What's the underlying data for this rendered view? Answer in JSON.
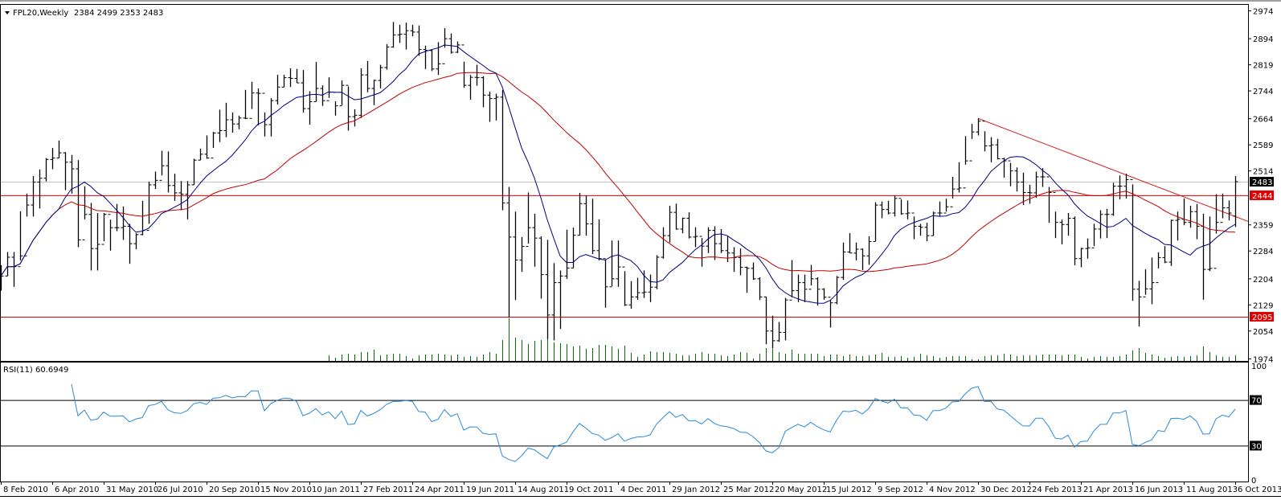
{
  "header": {
    "symbol_timeframe": "FPL20,Weekly",
    "ohlc_text": "2384 2499 2353 2483",
    "menu_icon": "triangle-down-icon"
  },
  "rsi_header": "RSI(11) 60.6949",
  "colors": {
    "bars": "#000000",
    "ma_fast": "#00007f",
    "ma_slow": "#c00000",
    "level_line": "#e00000",
    "trendline": "#d02020",
    "current_price_line": "#c0c0c0",
    "volume": "#007000",
    "rsi": "#2a8ad8"
  },
  "chart_data": [
    {
      "type": "ohlc",
      "title": "FPL20, Weekly",
      "bar_format": "[high, low, close]",
      "last_bar": {
        "open": 2384,
        "high": 2499,
        "low": 2353,
        "close": 2483
      },
      "ylim": [
        1974,
        2974
      ],
      "y_ticks": [
        "2974",
        "2894",
        "2819",
        "2744",
        "2664",
        "2589",
        "2514",
        "2359",
        "2284",
        "2204",
        "2129",
        "2054",
        "1974"
      ],
      "x_tick_labels": [
        {
          "bar": 1,
          "label": "8 Feb 2010"
        },
        {
          "bar": 9,
          "label": "6 Apr 2010"
        },
        {
          "bar": 17,
          "label": "31 May 2010"
        },
        {
          "bar": 25,
          "label": "26 Jul 2010"
        },
        {
          "bar": 33,
          "label": "20 Sep 2010"
        },
        {
          "bar": 41,
          "label": "15 Nov 2010"
        },
        {
          "bar": 49,
          "label": "10 Jan 2011"
        },
        {
          "bar": 57,
          "label": "27 Feb 2011"
        },
        {
          "bar": 65,
          "label": "24 Apr 2011"
        },
        {
          "bar": 73,
          "label": "19 Jun 2011"
        },
        {
          "bar": 81,
          "label": "14 Aug 2011"
        },
        {
          "bar": 89,
          "label": "9 Oct 2011"
        },
        {
          "bar": 97,
          "label": "4 Dec 2011"
        },
        {
          "bar": 105,
          "label": "29 Jan 2012"
        },
        {
          "bar": 113,
          "label": "25 Mar 2012"
        },
        {
          "bar": 121,
          "label": "20 May 2012"
        },
        {
          "bar": 129,
          "label": "15 Jul 2012"
        },
        {
          "bar": 137,
          "label": "9 Sep 2012"
        },
        {
          "bar": 145,
          "label": "4 Nov 2012"
        },
        {
          "bar": 153,
          "label": "30 Dec 2012"
        },
        {
          "bar": 161,
          "label": "24 Feb 2013"
        },
        {
          "bar": 169,
          "label": "21 Apr 2013"
        },
        {
          "bar": 177,
          "label": "16 Jun 2013"
        },
        {
          "bar": 185,
          "label": "11 Aug 2013"
        },
        {
          "bar": 193,
          "label": "6 Oct 2013"
        }
      ],
      "horizontal_levels": [
        {
          "price": 2444,
          "label": "2444",
          "style": "red"
        },
        {
          "price": 2095,
          "label": "2095",
          "style": "red"
        }
      ],
      "current_price": {
        "price": 2483,
        "label": "2483"
      },
      "trendline": {
        "from": {
          "bar": 153,
          "price": 2665
        },
        "to": {
          "bar": 195,
          "price": 2369
        }
      },
      "bars": [
        [
          2243,
          2170,
          2212
        ],
        [
          2281,
          2212,
          2266
        ],
        [
          2281,
          2181,
          2239
        ],
        [
          2398,
          2257,
          2270
        ],
        [
          2449,
          2383,
          2416
        ],
        [
          2499,
          2383,
          2482
        ],
        [
          2518,
          2406,
          2493
        ],
        [
          2551,
          2484,
          2547
        ],
        [
          2580,
          2519,
          2551
        ],
        [
          2601,
          2551,
          2566
        ],
        [
          2568,
          2459,
          2539
        ],
        [
          2560,
          2449,
          2520
        ],
        [
          2545,
          2295,
          2316
        ],
        [
          2470,
          2375,
          2389
        ],
        [
          2422,
          2228,
          2291
        ],
        [
          2393,
          2228,
          2303
        ],
        [
          2393,
          2312,
          2389
        ],
        [
          2374,
          2285,
          2351
        ],
        [
          2419,
          2341,
          2351
        ],
        [
          2412,
          2316,
          2355
        ],
        [
          2362,
          2247,
          2305
        ],
        [
          2335,
          2289,
          2331
        ],
        [
          2428,
          2329,
          2343
        ],
        [
          2483,
          2362,
          2474
        ],
        [
          2512,
          2462,
          2487
        ],
        [
          2572,
          2501,
          2529
        ],
        [
          2570,
          2452,
          2472
        ],
        [
          2506,
          2428,
          2451
        ],
        [
          2485,
          2401,
          2447
        ],
        [
          2485,
          2375,
          2474
        ],
        [
          2549,
          2474,
          2545
        ],
        [
          2578,
          2545,
          2562
        ],
        [
          2616,
          2549,
          2551
        ],
        [
          2626,
          2580,
          2623
        ],
        [
          2690,
          2597,
          2630
        ],
        [
          2710,
          2611,
          2661
        ],
        [
          2682,
          2624,
          2649
        ],
        [
          2673,
          2634,
          2666
        ],
        [
          2747,
          2663,
          2665
        ],
        [
          2770,
          2692,
          2738
        ],
        [
          2751,
          2645,
          2737
        ],
        [
          2682,
          2613,
          2647
        ],
        [
          2723,
          2613,
          2716
        ],
        [
          2790,
          2705,
          2755
        ],
        [
          2790,
          2755,
          2782
        ],
        [
          2809,
          2755,
          2780
        ],
        [
          2807,
          2767,
          2767
        ],
        [
          2804,
          2682,
          2693
        ],
        [
          2743,
          2647,
          2713
        ],
        [
          2827,
          2714,
          2751
        ],
        [
          2760,
          2701,
          2716
        ],
        [
          2783,
          2724,
          2740
        ],
        [
          2714,
          2673,
          2701
        ],
        [
          2774,
          2703,
          2760
        ],
        [
          2757,
          2630,
          2670
        ],
        [
          2691,
          2642,
          2674
        ],
        [
          2809,
          2666,
          2790
        ],
        [
          2830,
          2740,
          2751
        ],
        [
          2776,
          2703,
          2774
        ],
        [
          2819,
          2751,
          2811
        ],
        [
          2878,
          2805,
          2870
        ],
        [
          2942,
          2868,
          2905
        ],
        [
          2934,
          2882,
          2907
        ],
        [
          2940,
          2863,
          2917
        ],
        [
          2934,
          2901,
          2913
        ],
        [
          2932,
          2845,
          2863
        ],
        [
          2874,
          2807,
          2860
        ],
        [
          2863,
          2801,
          2807
        ],
        [
          2884,
          2790,
          2822
        ],
        [
          2924,
          2868,
          2894
        ],
        [
          2909,
          2851,
          2855
        ],
        [
          2886,
          2853,
          2876
        ],
        [
          2828,
          2753,
          2760
        ],
        [
          2790,
          2719,
          2783
        ],
        [
          2819,
          2759,
          2782
        ],
        [
          2786,
          2697,
          2732
        ],
        [
          2742,
          2655,
          2722
        ],
        [
          2736,
          2659,
          2726
        ],
        [
          2747,
          2401,
          2422
        ],
        [
          2468,
          2093,
          2324
        ],
        [
          2397,
          2143,
          2258
        ],
        [
          2324,
          2224,
          2297
        ],
        [
          2452,
          2305,
          2351
        ],
        [
          2391,
          2239,
          2321
        ],
        [
          2326,
          2147,
          2216
        ],
        [
          2316,
          2031,
          2100
        ],
        [
          2249,
          2027,
          2193
        ],
        [
          2228,
          2060,
          2212
        ],
        [
          2345,
          2204,
          2235
        ],
        [
          2351,
          2235,
          2329
        ],
        [
          2451,
          2329,
          2420
        ],
        [
          2443,
          2328,
          2362
        ],
        [
          2434,
          2275,
          2285
        ],
        [
          2375,
          2257,
          2262
        ],
        [
          2260,
          2121,
          2181
        ],
        [
          2314,
          2183,
          2204
        ],
        [
          2314,
          2181,
          2238
        ],
        [
          2226,
          2126,
          2129
        ],
        [
          2197,
          2118,
          2152
        ],
        [
          2207,
          2144,
          2164
        ],
        [
          2228,
          2149,
          2166
        ],
        [
          2216,
          2137,
          2180
        ],
        [
          2272,
          2174,
          2266
        ],
        [
          2352,
          2262,
          2328
        ],
        [
          2414,
          2308,
          2395
        ],
        [
          2420,
          2345,
          2347
        ],
        [
          2380,
          2335,
          2378
        ],
        [
          2395,
          2320,
          2324
        ],
        [
          2352,
          2295,
          2326
        ],
        [
          2321,
          2239,
          2298
        ],
        [
          2352,
          2278,
          2343
        ],
        [
          2355,
          2258,
          2305
        ],
        [
          2347,
          2278,
          2285
        ],
        [
          2328,
          2252,
          2278
        ],
        [
          2295,
          2224,
          2265
        ],
        [
          2291,
          2214,
          2237
        ],
        [
          2239,
          2164,
          2234
        ],
        [
          2251,
          2201,
          2204
        ],
        [
          2208,
          2143,
          2152
        ],
        [
          2152,
          2016,
          2054
        ],
        [
          2098,
          2004,
          2026
        ],
        [
          2080,
          2023,
          2050
        ],
        [
          2149,
          2027,
          2143
        ],
        [
          2258,
          2151,
          2170
        ],
        [
          2216,
          2137,
          2193
        ],
        [
          2216,
          2137,
          2174
        ],
        [
          2244,
          2185,
          2204
        ],
        [
          2208,
          2127,
          2174
        ],
        [
          2177,
          2144,
          2151
        ],
        [
          2143,
          2064,
          2135
        ],
        [
          2212,
          2131,
          2208
        ],
        [
          2308,
          2201,
          2281
        ],
        [
          2335,
          2278,
          2278
        ],
        [
          2308,
          2257,
          2289
        ],
        [
          2291,
          2229,
          2270
        ],
        [
          2326,
          2244,
          2311
        ],
        [
          2424,
          2312,
          2416
        ],
        [
          2426,
          2378,
          2403
        ],
        [
          2428,
          2389,
          2393
        ],
        [
          2443,
          2383,
          2435
        ],
        [
          2432,
          2388,
          2391
        ],
        [
          2429,
          2375,
          2393
        ],
        [
          2383,
          2318,
          2355
        ],
        [
          2362,
          2328,
          2352
        ],
        [
          2365,
          2312,
          2328
        ],
        [
          2397,
          2328,
          2393
        ],
        [
          2426,
          2383,
          2393
        ],
        [
          2434,
          2397,
          2411
        ],
        [
          2497,
          2435,
          2462
        ],
        [
          2539,
          2452,
          2465
        ],
        [
          2614,
          2532,
          2543
        ],
        [
          2649,
          2606,
          2626
        ],
        [
          2665,
          2616,
          2657
        ],
        [
          2628,
          2570,
          2586
        ],
        [
          2611,
          2539,
          2589
        ],
        [
          2606,
          2547,
          2549
        ],
        [
          2552,
          2495,
          2543
        ],
        [
          2537,
          2470,
          2514
        ],
        [
          2524,
          2455,
          2482
        ],
        [
          2509,
          2416,
          2452
        ],
        [
          2474,
          2420,
          2451
        ],
        [
          2512,
          2437,
          2497
        ],
        [
          2522,
          2468,
          2497
        ],
        [
          2468,
          2365,
          2452
        ],
        [
          2397,
          2321,
          2366
        ],
        [
          2374,
          2303,
          2360
        ],
        [
          2393,
          2328,
          2378
        ],
        [
          2383,
          2243,
          2262
        ],
        [
          2293,
          2237,
          2291
        ],
        [
          2320,
          2262,
          2293
        ],
        [
          2362,
          2298,
          2347
        ],
        [
          2401,
          2320,
          2389
        ],
        [
          2405,
          2321,
          2389
        ],
        [
          2480,
          2385,
          2470
        ],
        [
          2501,
          2432,
          2470
        ],
        [
          2506,
          2435,
          2489
        ],
        [
          2475,
          2141,
          2174
        ],
        [
          2198,
          2067,
          2152
        ],
        [
          2231,
          2158,
          2175
        ],
        [
          2265,
          2131,
          2193
        ],
        [
          2280,
          2234,
          2265
        ],
        [
          2298,
          2249,
          2252
        ],
        [
          2374,
          2241,
          2372
        ],
        [
          2397,
          2314,
          2375
        ],
        [
          2435,
          2358,
          2366
        ],
        [
          2414,
          2351,
          2397
        ],
        [
          2419,
          2318,
          2355
        ],
        [
          2391,
          2144,
          2231
        ],
        [
          2383,
          2226,
          2234
        ],
        [
          2447,
          2334,
          2366
        ],
        [
          2449,
          2378,
          2408
        ],
        [
          2429,
          2372,
          2393
        ],
        [
          2499,
          2353,
          2483
        ]
      ],
      "volume_start_bar": 52,
      "volume": [
        7,
        4,
        8,
        9,
        8,
        11,
        11,
        14,
        7,
        8,
        9,
        9,
        6,
        3,
        7,
        8,
        8,
        9,
        8,
        7,
        8,
        5,
        6,
        5,
        8,
        11,
        9,
        26,
        53,
        29,
        26,
        21,
        25,
        26,
        28,
        23,
        22,
        21,
        18,
        19,
        15,
        16,
        20,
        20,
        18,
        15,
        19,
        10,
        5,
        8,
        12,
        11,
        11,
        10,
        9,
        7,
        7,
        9,
        11,
        9,
        9,
        7,
        6,
        8,
        11,
        10,
        3,
        9,
        16,
        15,
        11,
        9,
        14,
        9,
        9,
        9,
        9,
        6,
        8,
        8,
        6,
        8,
        6,
        6,
        7,
        8,
        10,
        5,
        5,
        6,
        4,
        5,
        9,
        7,
        6,
        4,
        5,
        6,
        6,
        6,
        2,
        2,
        6,
        7,
        7,
        9,
        8,
        6,
        7,
        7,
        7,
        8,
        8,
        8,
        7,
        8,
        8,
        5,
        3,
        5,
        6,
        5,
        5,
        6,
        8,
        13,
        16,
        10,
        8,
        6,
        4,
        5,
        6,
        5,
        6,
        7,
        18,
        11,
        7,
        5,
        5,
        7
      ]
    },
    {
      "type": "line",
      "title": "RSI(11)",
      "period": 11,
      "ylim": [
        0,
        100
      ],
      "y_ticks": [
        "100",
        "70",
        "30",
        "0"
      ],
      "levels": [
        70,
        30
      ],
      "last_value": 60.6949
    }
  ]
}
